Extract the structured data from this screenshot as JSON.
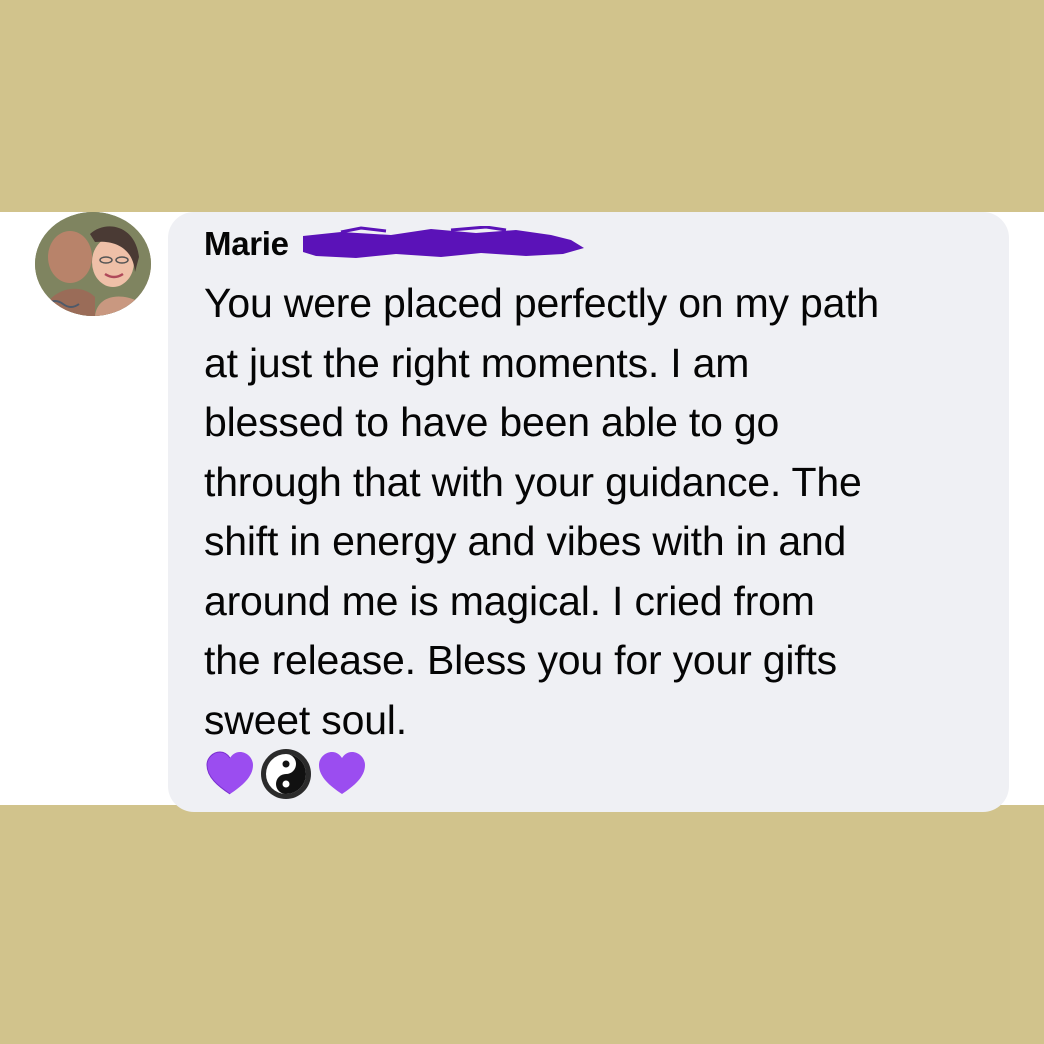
{
  "comment": {
    "author_name": "Marie",
    "author_last_name_redacted": true,
    "redaction_color": "#5b12b8",
    "text": "You were placed perfectly on my path\nat just the right moments. I am\nblessed to have been able to go\nthrough that with your guidance. The\nshift in energy and vibes with in and\naround me is magical. I cried from\nthe release. Bless you for your gifts\nsweet soul.",
    "emojis": [
      "purple-heart",
      "yin-yang",
      "purple-heart"
    ]
  },
  "colors": {
    "background": "#d1c38c",
    "card": "#ffffff",
    "bubble": "#eff0f4",
    "text": "#050505",
    "heart": "#9b4df0"
  }
}
